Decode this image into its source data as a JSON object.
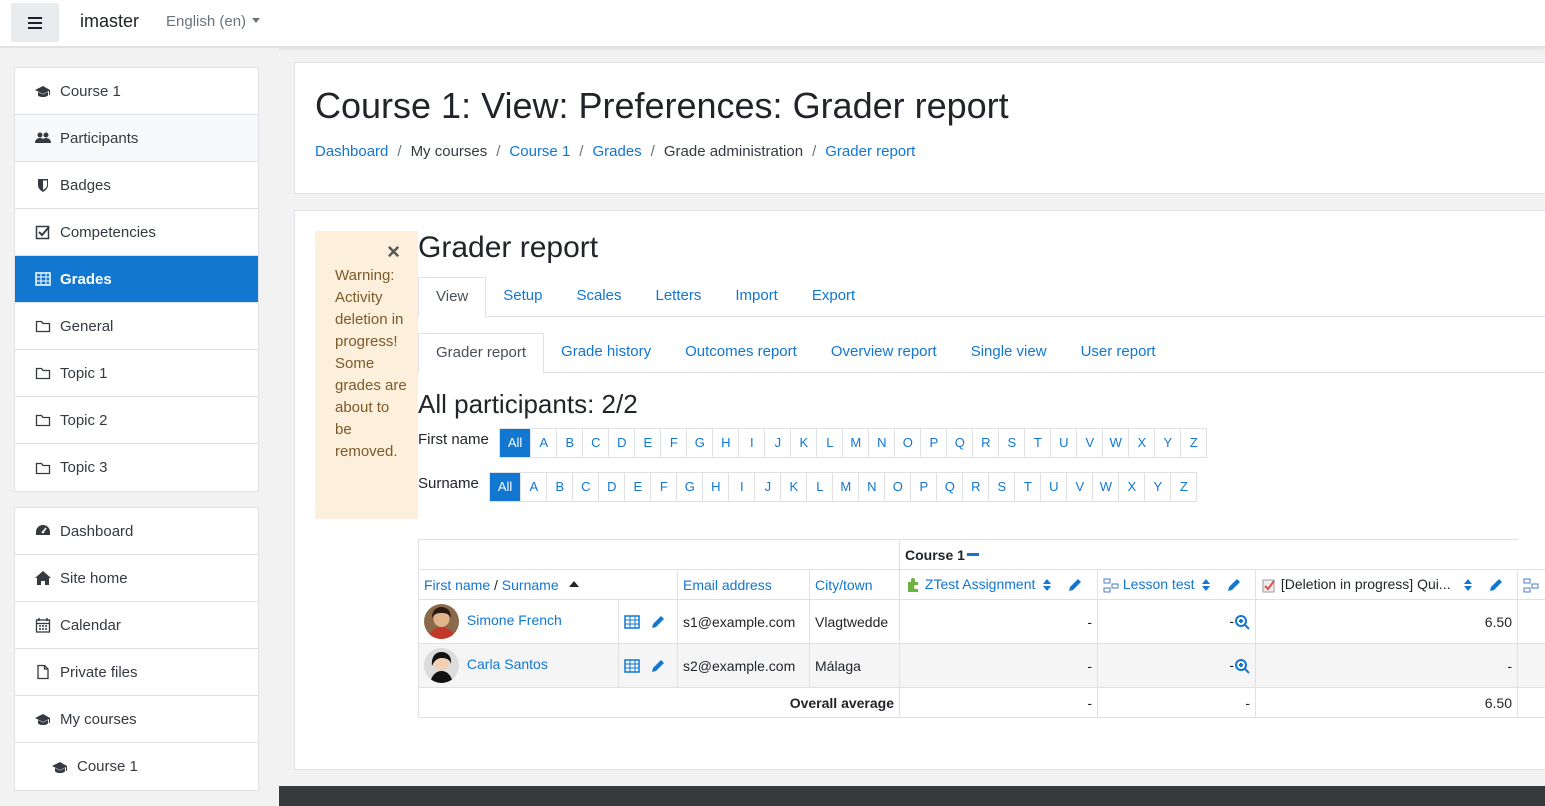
{
  "navbar": {
    "brand": "imaster",
    "language": "English (en)"
  },
  "sidebar": {
    "course_items": [
      {
        "label": "Course 1",
        "icon": "graduation-cap-icon"
      },
      {
        "label": "Participants",
        "icon": "users-icon"
      },
      {
        "label": "Badges",
        "icon": "shield-icon"
      },
      {
        "label": "Competencies",
        "icon": "check-square-icon"
      },
      {
        "label": "Grades",
        "icon": "table-icon",
        "active": true
      },
      {
        "label": "General",
        "icon": "folder-icon"
      },
      {
        "label": "Topic 1",
        "icon": "folder-icon"
      },
      {
        "label": "Topic 2",
        "icon": "folder-icon"
      },
      {
        "label": "Topic 3",
        "icon": "folder-icon"
      }
    ],
    "site_items": [
      {
        "label": "Dashboard",
        "icon": "dashboard-icon"
      },
      {
        "label": "Site home",
        "icon": "home-icon"
      },
      {
        "label": "Calendar",
        "icon": "calendar-icon"
      },
      {
        "label": "Private files",
        "icon": "file-icon"
      },
      {
        "label": "My courses",
        "icon": "graduation-cap-icon"
      },
      {
        "label": "Course 1",
        "icon": "graduation-cap-icon"
      }
    ]
  },
  "header": {
    "title": "Course 1: View: Preferences: Grader report",
    "breadcrumb": [
      {
        "label": "Dashboard",
        "link": true
      },
      {
        "label": "My courses",
        "link": false
      },
      {
        "label": "Course 1",
        "link": true
      },
      {
        "label": "Grades",
        "link": true
      },
      {
        "label": "Grade administration",
        "link": false
      },
      {
        "label": "Grader report",
        "link": true
      }
    ]
  },
  "warning": {
    "text": "Warning: Activity deletion in progress! Some grades are about to be removed.",
    "close": "×"
  },
  "report": {
    "heading": "Grader report",
    "tabs": [
      "View",
      "Setup",
      "Scales",
      "Letters",
      "Import",
      "Export"
    ],
    "subtabs": [
      "Grader report",
      "Grade history",
      "Outcomes report",
      "Overview report",
      "Single view",
      "User report"
    ],
    "participants_heading": "All participants: 2/2",
    "firstname_label": "First name",
    "surname_label": "Surname",
    "letters": [
      "All",
      "A",
      "B",
      "C",
      "D",
      "E",
      "F",
      "G",
      "H",
      "I",
      "J",
      "K",
      "L",
      "M",
      "N",
      "O",
      "P",
      "Q",
      "R",
      "S",
      "T",
      "U",
      "V",
      "W",
      "X",
      "Y",
      "Z"
    ]
  },
  "table": {
    "course_header": "Course 1",
    "col_firstname": "First name",
    "col_slash": " / ",
    "col_surname": "Surname",
    "col_email": "Email address",
    "col_city": "City/town",
    "col_assignment": "ZTest Assignment",
    "col_lesson": "Lesson test",
    "col_quiz": "[Deletion in progress] Qui...",
    "rows": [
      {
        "name": "Simone French",
        "email": "s1@example.com",
        "city": "Vlagtwedde",
        "assignment": "-",
        "lesson": "-",
        "quiz": "6.50"
      },
      {
        "name": "Carla Santos",
        "email": "s2@example.com",
        "city": "Málaga",
        "assignment": "-",
        "lesson": "-",
        "quiz": "-"
      }
    ],
    "overall_label": "Overall average",
    "overall": {
      "assignment": "-",
      "lesson": "-",
      "quiz": "6.50"
    }
  }
}
